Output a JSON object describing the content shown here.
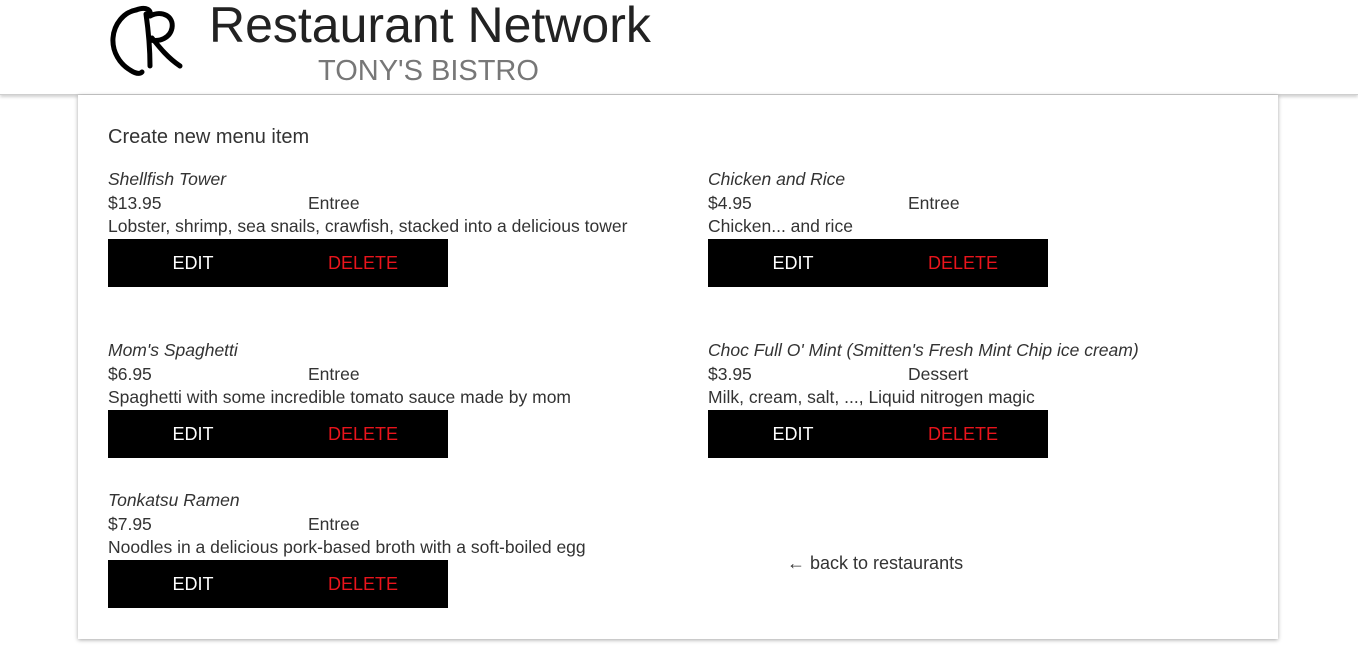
{
  "header": {
    "site_title": "Restaurant Network",
    "restaurant_name": "TONY'S BISTRO",
    "logo_icon": "restaurant-network-logo"
  },
  "main": {
    "create_link": "Create new menu item",
    "back_link": "← back to restaurants",
    "items": [
      {
        "name": "Shellfish Tower",
        "price": "$13.95",
        "category": "Entree",
        "description": "Lobster, shrimp, sea snails, crawfish, stacked into a delicious tower",
        "edit_label": "EDIT",
        "delete_label": "DELETE"
      },
      {
        "name": "Chicken and Rice",
        "price": "$4.95",
        "category": "Entree",
        "description": "Chicken... and rice",
        "edit_label": "EDIT",
        "delete_label": "DELETE"
      },
      {
        "name": "Mom's Spaghetti",
        "price": "$6.95",
        "category": "Entree",
        "description": "Spaghetti with some incredible tomato sauce made by mom",
        "edit_label": "EDIT",
        "delete_label": "DELETE"
      },
      {
        "name": "Choc Full O' Mint (Smitten's Fresh Mint Chip ice cream)",
        "price": "$3.95",
        "category": "Dessert",
        "description": "Milk, cream, salt, ..., Liquid nitrogen magic",
        "edit_label": "EDIT",
        "delete_label": "DELETE"
      },
      {
        "name": "Tonkatsu Ramen",
        "price": "$7.95",
        "category": "Entree",
        "description": "Noodles in a delicious pork-based broth with a soft-boiled egg",
        "edit_label": "EDIT",
        "delete_label": "DELETE"
      }
    ]
  },
  "colors": {
    "button_background": "#000000",
    "edit_text": "#ffffff",
    "delete_text": "#e8141c",
    "subtitle_text": "#777777"
  }
}
